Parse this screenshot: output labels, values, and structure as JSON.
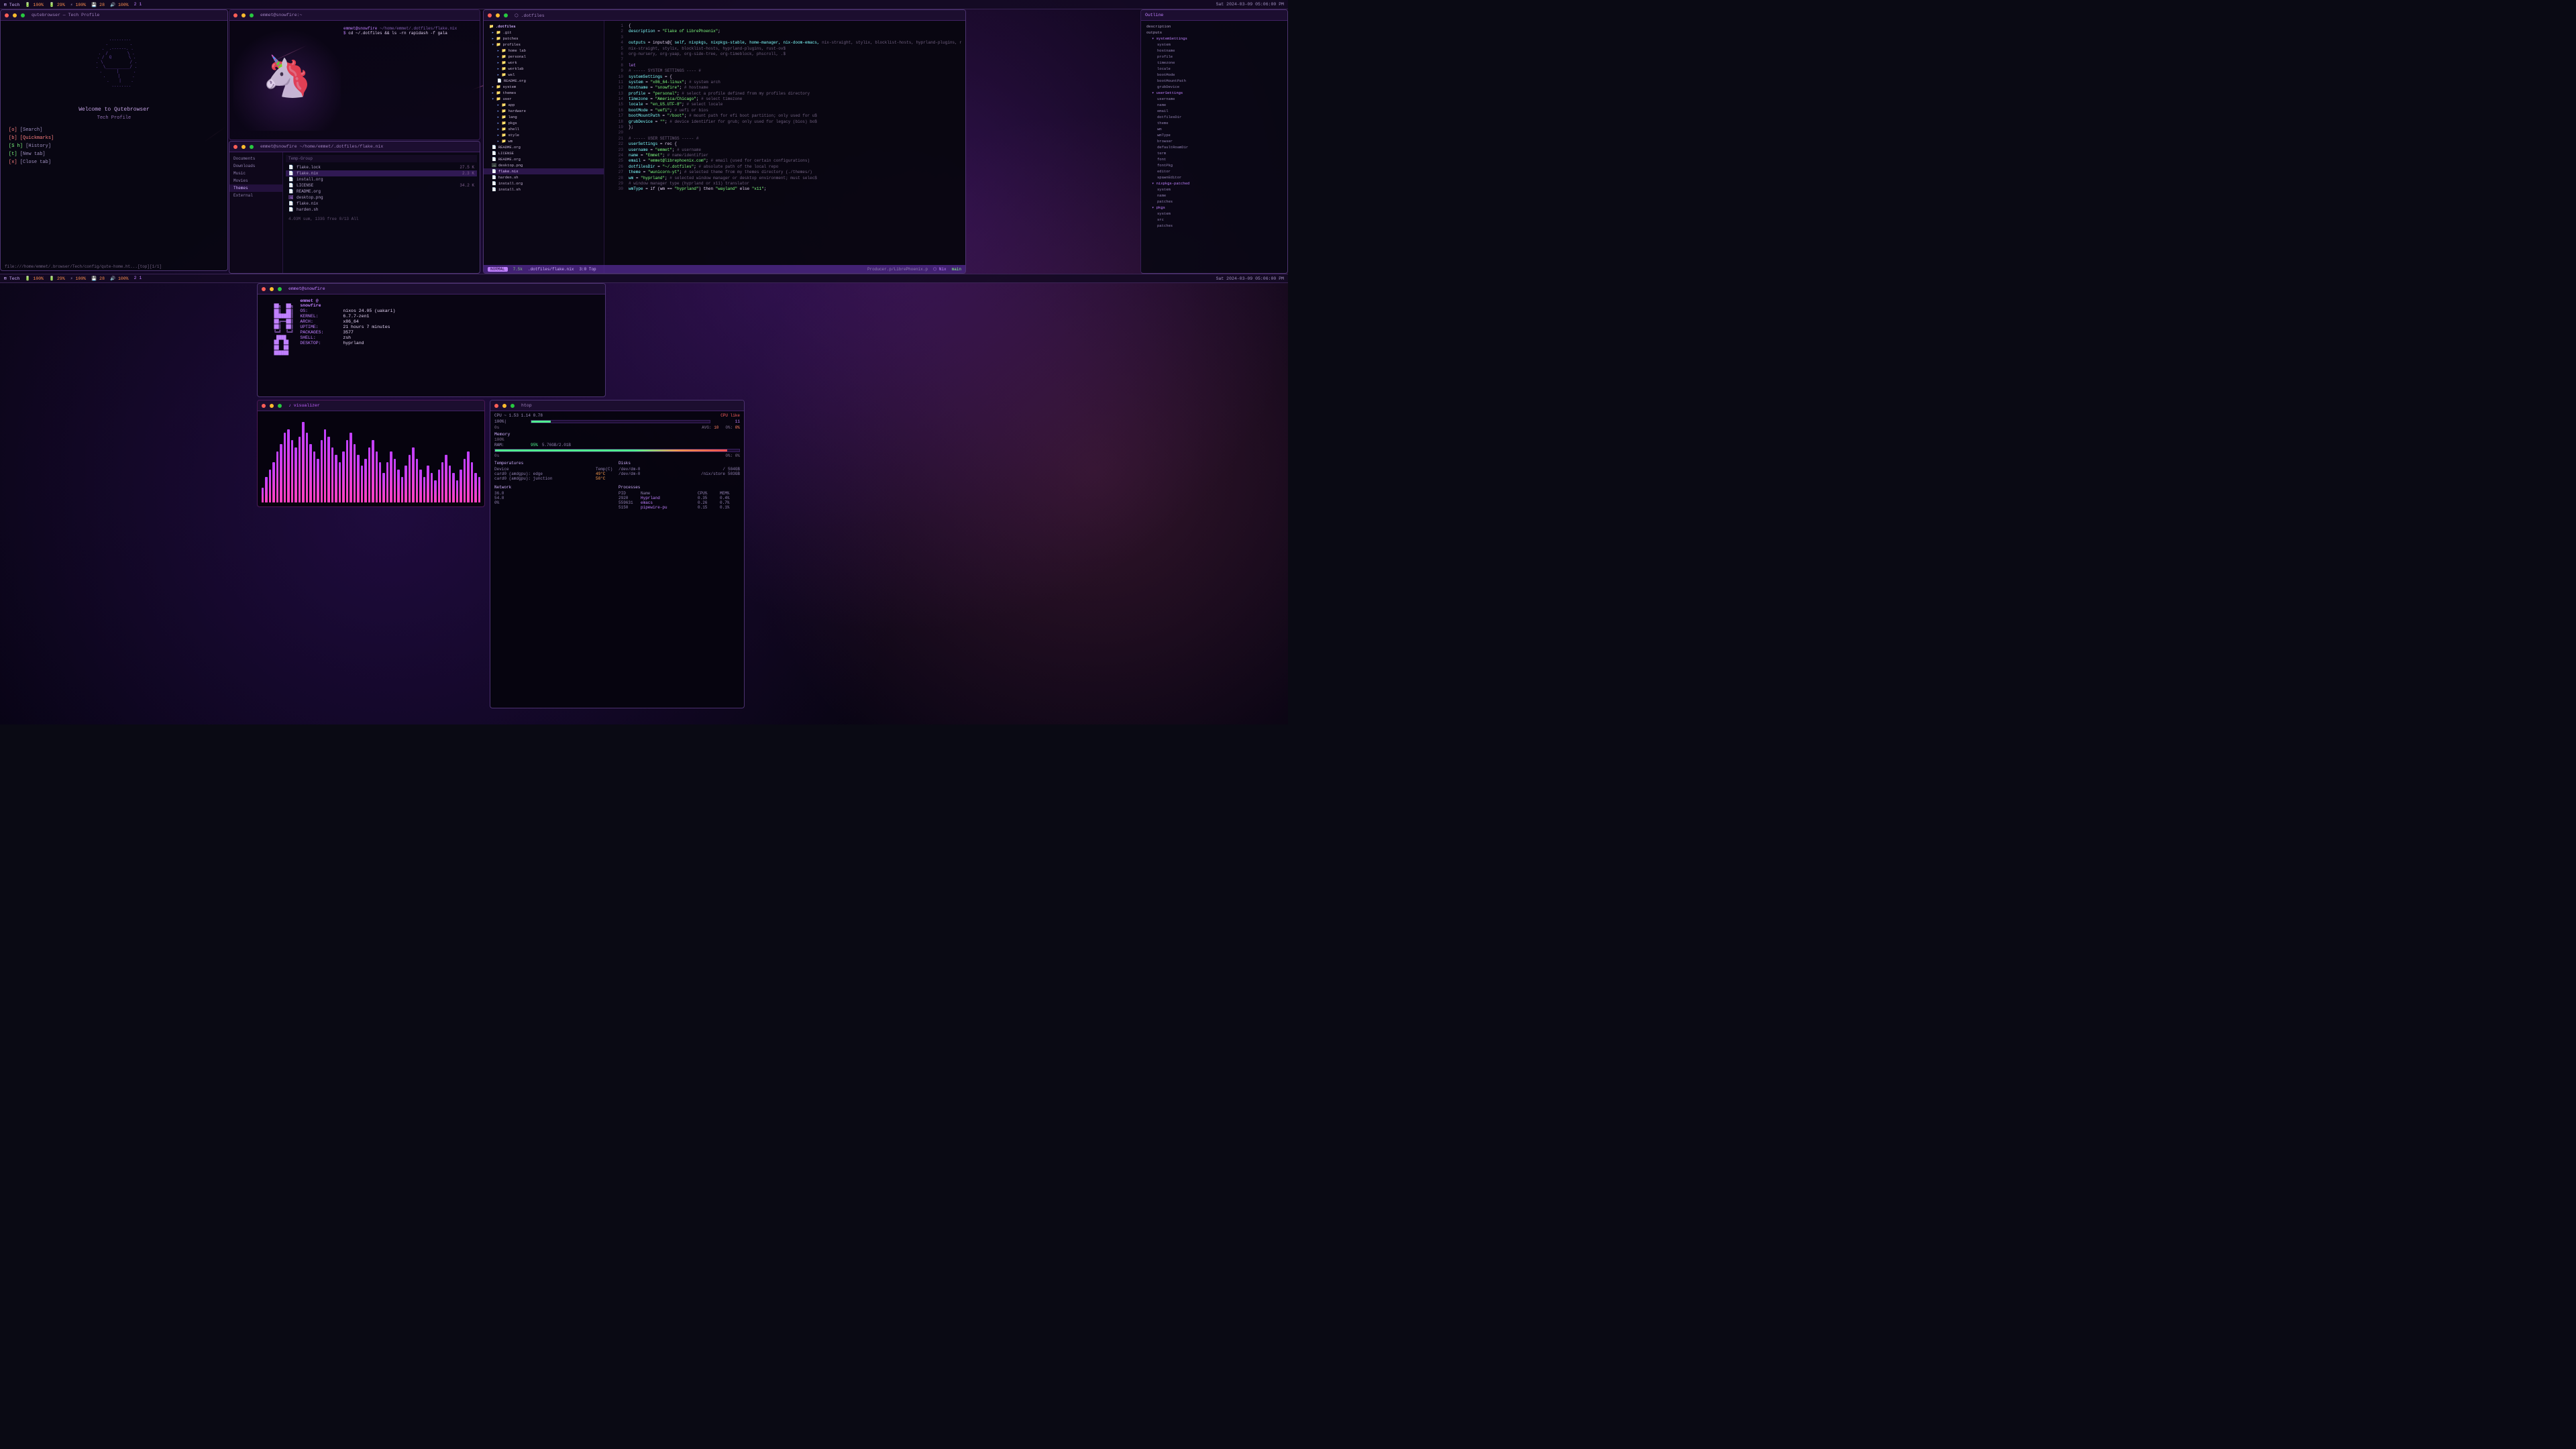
{
  "statusbar": {
    "left": {
      "tag1": "Tech",
      "bat1": "100%",
      "bat2": "29%",
      "cpu": "100%",
      "mem": "28",
      "vol": "100%",
      "num1": "2",
      "num2": "1",
      "datetime": "Sat 2024-03-09 05:06:00 PM"
    }
  },
  "qute": {
    "title": "Welcome to Qutebrowser",
    "subtitle": "Tech Profile",
    "menu": [
      {
        "key": "[o]",
        "label": " [Search]"
      },
      {
        "key": "[b]",
        "label": " [Quickmarks]",
        "highlighted": true
      },
      {
        "key": "[S h]",
        "label": " [History]"
      },
      {
        "key": "[t]",
        "label": " [New tab]"
      },
      {
        "key": "[x]",
        "label": " [Close tab]"
      }
    ],
    "status": "file:///home/emmet/.browser/Tech/config/qute-home.ht...[top][1/1]"
  },
  "files": {
    "path": "emmet@snowfire ~/home/emmet/.dotfiles/flake.nix",
    "command": "cd ~/.dotfiles && ls -rn rapidash -f gala",
    "sidebar": [
      "Documents",
      "Downloads",
      "Music",
      "Movies",
      "Themes",
      "External"
    ],
    "items": [
      {
        "type": "file",
        "name": "flake.lock",
        "size": "27.5 K"
      },
      {
        "type": "file",
        "name": "flake.nix",
        "size": "2.3 K",
        "selected": true
      },
      {
        "type": "file",
        "name": "install.org",
        "size": ""
      },
      {
        "type": "file",
        "name": "LICENSE",
        "size": "34.2 K"
      },
      {
        "type": "file",
        "name": "README.org",
        "size": ""
      }
    ]
  },
  "nvim": {
    "filepath": ".dotfiles/flake.nix",
    "tree": {
      "root": ".dotfiles",
      "items": [
        {
          "type": "folder",
          "name": ".git",
          "indent": 0
        },
        {
          "type": "folder",
          "name": "patches",
          "indent": 0
        },
        {
          "type": "folder",
          "name": "profiles",
          "indent": 0
        },
        {
          "type": "folder",
          "name": "home lab",
          "indent": 1
        },
        {
          "type": "folder",
          "name": "personal",
          "indent": 1
        },
        {
          "type": "folder",
          "name": "work",
          "indent": 1
        },
        {
          "type": "folder",
          "name": "worklab",
          "indent": 1
        },
        {
          "type": "folder",
          "name": "wsl",
          "indent": 1
        },
        {
          "type": "file",
          "name": "README.org",
          "indent": 1
        },
        {
          "type": "folder",
          "name": "system",
          "indent": 0
        },
        {
          "type": "folder",
          "name": "themes",
          "indent": 0
        },
        {
          "type": "folder",
          "name": "user",
          "indent": 0
        },
        {
          "type": "folder",
          "name": "app",
          "indent": 1
        },
        {
          "type": "folder",
          "name": "hardware",
          "indent": 1
        },
        {
          "type": "folder",
          "name": "lang",
          "indent": 1
        },
        {
          "type": "folder",
          "name": "pkgs",
          "indent": 1
        },
        {
          "type": "folder",
          "name": "shell",
          "indent": 1
        },
        {
          "type": "folder",
          "name": "style",
          "indent": 1
        },
        {
          "type": "folder",
          "name": "wm",
          "indent": 1
        },
        {
          "type": "file",
          "name": "README.org",
          "indent": 1
        },
        {
          "type": "file",
          "name": "LICENSE",
          "indent": 0
        },
        {
          "type": "file",
          "name": "README.org",
          "indent": 0
        },
        {
          "type": "file",
          "name": "desktop.png",
          "indent": 0
        },
        {
          "type": "file",
          "name": "flake.nix",
          "indent": 0,
          "selected": true
        },
        {
          "type": "file",
          "name": "harden.sh",
          "indent": 0
        },
        {
          "type": "file",
          "name": "install.org",
          "indent": 0
        },
        {
          "type": "file",
          "name": "install.sh",
          "indent": 0
        }
      ]
    },
    "code": [
      {
        "num": "1",
        "text": "  {"
      },
      {
        "num": "2",
        "text": "    description = \"Flake of LibrePhoenix\";"
      },
      {
        "num": "3",
        "text": ""
      },
      {
        "num": "4",
        "text": "    outputs = inputs@{ self, nixpkgs, nixpkgs-stable, home-manager, nix-doom-emacs,"
      },
      {
        "num": "5",
        "text": "                         nix-straight, stylix, blocklist-hosts, hyprland-plugins, rust-ov$"
      },
      {
        "num": "6",
        "text": "                         org-nursery, org-yaap, org-side-tree, org-timeblock, phscroll, .$"
      },
      {
        "num": "7",
        "text": ""
      },
      {
        "num": "8",
        "text": "    let"
      },
      {
        "num": "9",
        "text": "      # ----- SYSTEM SETTINGS ---- #"
      },
      {
        "num": "10",
        "text": "      systemSettings = {"
      },
      {
        "num": "11",
        "text": "        system = \"x86_64-linux\"; # system arch"
      },
      {
        "num": "12",
        "text": "        hostname = \"snowfire\"; # hostname"
      },
      {
        "num": "13",
        "text": "        profile = \"personal\"; # select a profile defined from my profiles directory"
      },
      {
        "num": "14",
        "text": "        timezone = \"America/Chicago\"; # select timezone"
      },
      {
        "num": "15",
        "text": "        locale = \"en_US.UTF-8\"; # select locale"
      },
      {
        "num": "16",
        "text": "        bootMode = \"uefi\"; # uefi or bios"
      },
      {
        "num": "17",
        "text": "        bootMountPath = \"/boot\"; # mount path for efi boot partition; only used for u$"
      },
      {
        "num": "18",
        "text": "        grubDevice = \"\"; # device identifier for grub; only used for legacy (bios) bo$"
      },
      {
        "num": "19",
        "text": "      };"
      },
      {
        "num": "20",
        "text": ""
      },
      {
        "num": "21",
        "text": "      # ----- USER SETTINGS ----- #"
      },
      {
        "num": "22",
        "text": "      userSettings = rec {"
      },
      {
        "num": "23",
        "text": "        username = \"emmet\"; # username"
      },
      {
        "num": "24",
        "text": "        name = \"Emmet\"; # name/identifier"
      },
      {
        "num": "25",
        "text": "        email = \"emmet@librephoenix.com\"; # email (used for certain configurations)"
      },
      {
        "num": "26",
        "text": "        dotfilesDir = \"~/.dotfiles\"; # absolute path of the local repo"
      },
      {
        "num": "27",
        "text": "        theme = \"wunicorn-yt\"; # selected theme from my themes directory (./themes/)"
      },
      {
        "num": "28",
        "text": "        wm = \"hyprland\"; # selected window manager or desktop environment; must selec$"
      },
      {
        "num": "29",
        "text": "        # window manager type (hyprland or x11) translator"
      },
      {
        "num": "30",
        "text": "        wmType = if (wm == \"hyprland\") then \"wayland\" else \"x11\";"
      }
    ],
    "statusline": {
      "mode": "NORMAL",
      "file": ".dotfiles/flake.nix",
      "position": "3:0 Top",
      "producer": "Producer.p/LibrePhoenix.p",
      "lang": "Nix",
      "branch": "main"
    },
    "right_tree": {
      "items": [
        {
          "name": "description",
          "indent": 0
        },
        {
          "name": "outputs",
          "indent": 0
        },
        {
          "name": "systemSettings",
          "indent": 1
        },
        {
          "name": "system",
          "indent": 2
        },
        {
          "name": "hostname",
          "indent": 2
        },
        {
          "name": "profile",
          "indent": 2
        },
        {
          "name": "timezone",
          "indent": 2
        },
        {
          "name": "locale",
          "indent": 2
        },
        {
          "name": "bootMode",
          "indent": 2
        },
        {
          "name": "bootMountPath",
          "indent": 2
        },
        {
          "name": "grubDevice",
          "indent": 2
        },
        {
          "name": "userSettings",
          "indent": 1
        },
        {
          "name": "username",
          "indent": 2
        },
        {
          "name": "name",
          "indent": 2
        },
        {
          "name": "email",
          "indent": 2
        },
        {
          "name": "dotfilesDir",
          "indent": 2
        },
        {
          "name": "theme",
          "indent": 2
        },
        {
          "name": "wm",
          "indent": 2
        },
        {
          "name": "wmType",
          "indent": 2
        },
        {
          "name": "browser",
          "indent": 2
        },
        {
          "name": "defaultRoamDir",
          "indent": 2
        },
        {
          "name": "term",
          "indent": 2
        },
        {
          "name": "font",
          "indent": 2
        },
        {
          "name": "fontPkg",
          "indent": 2
        },
        {
          "name": "editor",
          "indent": 2
        },
        {
          "name": "spawnEditor",
          "indent": 2
        },
        {
          "name": "nixpkgs-patched",
          "indent": 1
        },
        {
          "name": "system",
          "indent": 2
        },
        {
          "name": "name",
          "indent": 2
        },
        {
          "name": "patches",
          "indent": 2
        },
        {
          "name": "pkgs",
          "indent": 1
        },
        {
          "name": "system",
          "indent": 2
        },
        {
          "name": "src",
          "indent": 2
        },
        {
          "name": "patches",
          "indent": 2
        }
      ]
    }
  },
  "neofetch": {
    "user": "emmet @ snowfire",
    "os": "nixos 24.05 (uakari)",
    "kernel": "6.7.7-zen1",
    "arch": "x86_64",
    "uptime": "21 hours 7 minutes",
    "packages": "3577",
    "shell": "zsh",
    "desktop": "hyprland"
  },
  "htop": {
    "cpu_label": "CPU ~ 1.53 1.14 0.78",
    "cpu_pct": "11%",
    "avg": "10",
    "memory": {
      "label": "Memory",
      "used": "5.76GB",
      "total": "2.01B",
      "pct": "95%"
    },
    "temperatures": {
      "card0_edge": "49°C",
      "card0_junction": "58°C"
    },
    "disks": [
      {
        "dev": "/dev/dm-0",
        "path": "/",
        "size": "504GB"
      },
      {
        "dev": "/dev/dm-0",
        "path": "/nix/store",
        "size": "503GB"
      }
    ],
    "network": {
      "rx_1": "36.0",
      "rx_2": "54.0",
      "rx_3": "0%"
    },
    "processes": [
      {
        "pid": "2920",
        "name": "Hyprland",
        "cpu": "0.35",
        "mem": "0.4%"
      },
      {
        "pid": "559631",
        "name": "emacs",
        "cpu": "0.26",
        "mem": "0.7%"
      },
      {
        "pid": "5150",
        "name": "pipewire-pu",
        "cpu": "0.15",
        "mem": "0.1%"
      }
    ]
  },
  "visualizer": {
    "bars": [
      20,
      35,
      45,
      55,
      70,
      80,
      95,
      100,
      85,
      75,
      90,
      110,
      95,
      80,
      70,
      60,
      85,
      100,
      90,
      75,
      65,
      55,
      70,
      85,
      95,
      80,
      65,
      50,
      60,
      75,
      85,
      70,
      55,
      40,
      55,
      70,
      60,
      45,
      35,
      50,
      65,
      75,
      60,
      45,
      35,
      50,
      40,
      30,
      45,
      55,
      65,
      50,
      40,
      30,
      45,
      60,
      70,
      55,
      40,
      35
    ]
  }
}
